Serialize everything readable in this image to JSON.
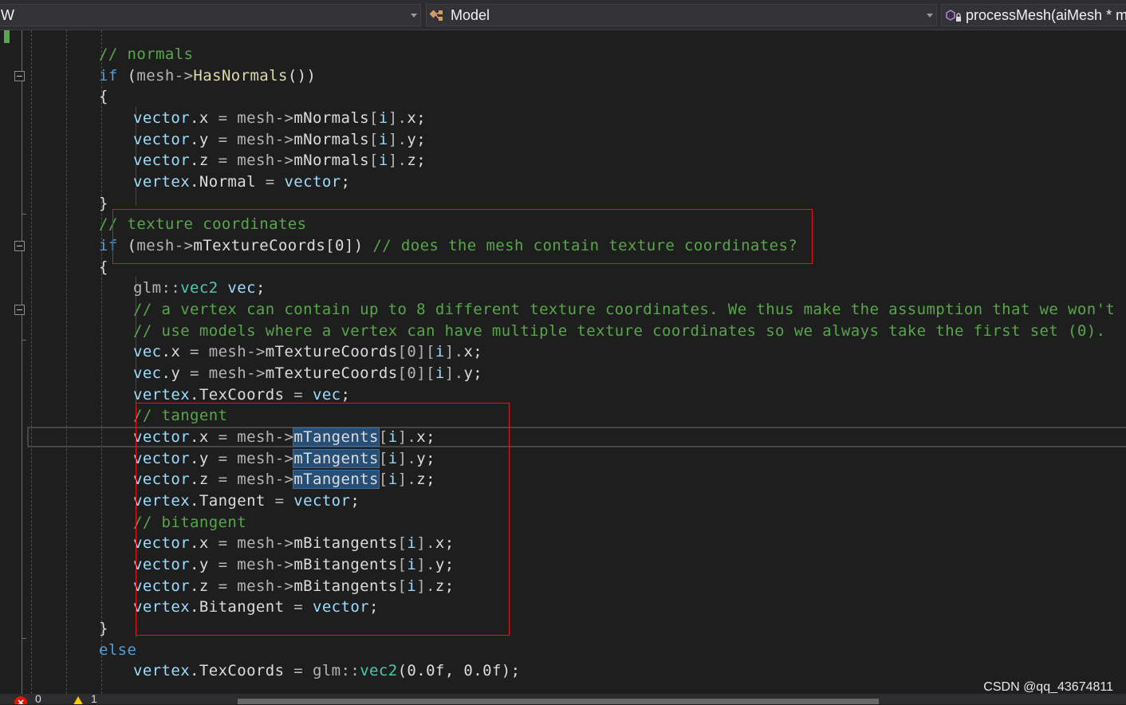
{
  "navbar": {
    "project_text": "W",
    "class_text": "Model",
    "member_text": "processMesh(aiMesh * m"
  },
  "icons": {
    "class": "class-icon",
    "member": "method-icon",
    "error": "error-icon",
    "warning": "warning-icon"
  },
  "status": {
    "errors": "0",
    "warnings": "1"
  },
  "watermark": "CSDN @qq_43674811",
  "colors": {
    "comment": "#57a64a",
    "keyword": "#569cd6",
    "identifier": "#9cdcfe",
    "function": "#dcdcaa",
    "type": "#4ec9b0",
    "highlight_box": "#e81123",
    "selection": "#264f78"
  },
  "code": {
    "lines": [
      {
        "indent": 2,
        "tokens": [
          {
            "t": "// normals",
            "c": "cm"
          }
        ]
      },
      {
        "indent": 2,
        "tokens": [
          {
            "t": "if",
            "c": "kw"
          },
          {
            "t": " ("
          },
          {
            "t": "mesh",
            "c": "op"
          },
          {
            "t": "->",
            "c": "op"
          },
          {
            "t": "HasNormals",
            "c": "fn"
          },
          {
            "t": "())"
          }
        ]
      },
      {
        "indent": 2,
        "tokens": [
          {
            "t": "{"
          }
        ]
      },
      {
        "indent": 3,
        "tokens": [
          {
            "t": "vector",
            "c": "id"
          },
          {
            "t": "."
          },
          {
            "t": "x"
          },
          {
            "t": " = ",
            "c": "op"
          },
          {
            "t": "mesh",
            "c": "op"
          },
          {
            "t": "->",
            "c": "op"
          },
          {
            "t": "mNormals"
          },
          {
            "t": "[",
            "c": "op"
          },
          {
            "t": "i",
            "c": "id"
          },
          {
            "t": "].",
            "c": "op"
          },
          {
            "t": "x"
          },
          {
            "t": ";"
          }
        ]
      },
      {
        "indent": 3,
        "tokens": [
          {
            "t": "vector",
            "c": "id"
          },
          {
            "t": "."
          },
          {
            "t": "y"
          },
          {
            "t": " = ",
            "c": "op"
          },
          {
            "t": "mesh",
            "c": "op"
          },
          {
            "t": "->",
            "c": "op"
          },
          {
            "t": "mNormals"
          },
          {
            "t": "[",
            "c": "op"
          },
          {
            "t": "i",
            "c": "id"
          },
          {
            "t": "].",
            "c": "op"
          },
          {
            "t": "y"
          },
          {
            "t": ";"
          }
        ]
      },
      {
        "indent": 3,
        "tokens": [
          {
            "t": "vector",
            "c": "id"
          },
          {
            "t": "."
          },
          {
            "t": "z"
          },
          {
            "t": " = ",
            "c": "op"
          },
          {
            "t": "mesh",
            "c": "op"
          },
          {
            "t": "->",
            "c": "op"
          },
          {
            "t": "mNormals"
          },
          {
            "t": "[",
            "c": "op"
          },
          {
            "t": "i",
            "c": "id"
          },
          {
            "t": "].",
            "c": "op"
          },
          {
            "t": "z"
          },
          {
            "t": ";"
          }
        ]
      },
      {
        "indent": 3,
        "tokens": [
          {
            "t": "vertex",
            "c": "id"
          },
          {
            "t": "."
          },
          {
            "t": "Normal"
          },
          {
            "t": " = ",
            "c": "op"
          },
          {
            "t": "vector",
            "c": "id"
          },
          {
            "t": ";"
          }
        ]
      },
      {
        "indent": 2,
        "tokens": [
          {
            "t": "}"
          }
        ]
      },
      {
        "indent": 2,
        "tokens": [
          {
            "t": "// texture coordinates",
            "c": "cm"
          }
        ]
      },
      {
        "indent": 2,
        "tokens": [
          {
            "t": "if",
            "c": "kw"
          },
          {
            "t": " ("
          },
          {
            "t": "mesh",
            "c": "op"
          },
          {
            "t": "->",
            "c": "op"
          },
          {
            "t": "mTextureCoords"
          },
          {
            "t": "[0])"
          },
          {
            "t": " // does the mesh contain texture coordinates?",
            "c": "cm"
          }
        ]
      },
      {
        "indent": 2,
        "tokens": [
          {
            "t": "{"
          }
        ]
      },
      {
        "indent": 3,
        "tokens": [
          {
            "t": "glm",
            "c": "op"
          },
          {
            "t": "::",
            "c": "op"
          },
          {
            "t": "vec2",
            "c": "ty"
          },
          {
            "t": " "
          },
          {
            "t": "vec",
            "c": "id"
          },
          {
            "t": ";"
          }
        ]
      },
      {
        "indent": 3,
        "tokens": [
          {
            "t": "// a vertex can contain up to 8 different texture coordinates. We thus make the assumption that we won't",
            "c": "cm"
          }
        ]
      },
      {
        "indent": 3,
        "tokens": [
          {
            "t": "// use models where a vertex can have multiple texture coordinates so we always take the first set (0).",
            "c": "cm"
          }
        ]
      },
      {
        "indent": 3,
        "tokens": [
          {
            "t": "vec",
            "c": "id"
          },
          {
            "t": "."
          },
          {
            "t": "x"
          },
          {
            "t": " = ",
            "c": "op"
          },
          {
            "t": "mesh",
            "c": "op"
          },
          {
            "t": "->",
            "c": "op"
          },
          {
            "t": "mTextureCoords"
          },
          {
            "t": "[0][",
            "c": "op"
          },
          {
            "t": "i",
            "c": "id"
          },
          {
            "t": "].",
            "c": "op"
          },
          {
            "t": "x"
          },
          {
            "t": ";"
          }
        ]
      },
      {
        "indent": 3,
        "tokens": [
          {
            "t": "vec",
            "c": "id"
          },
          {
            "t": "."
          },
          {
            "t": "y"
          },
          {
            "t": " = ",
            "c": "op"
          },
          {
            "t": "mesh",
            "c": "op"
          },
          {
            "t": "->",
            "c": "op"
          },
          {
            "t": "mTextureCoords"
          },
          {
            "t": "[0][",
            "c": "op"
          },
          {
            "t": "i",
            "c": "id"
          },
          {
            "t": "].",
            "c": "op"
          },
          {
            "t": "y"
          },
          {
            "t": ";"
          }
        ]
      },
      {
        "indent": 3,
        "tokens": [
          {
            "t": "vertex",
            "c": "id"
          },
          {
            "t": "."
          },
          {
            "t": "TexCoords"
          },
          {
            "t": " = ",
            "c": "op"
          },
          {
            "t": "vec",
            "c": "id"
          },
          {
            "t": ";"
          }
        ]
      },
      {
        "indent": 3,
        "tokens": [
          {
            "t": "// tangent",
            "c": "cm"
          }
        ]
      },
      {
        "indent": 3,
        "tokens": [
          {
            "t": "vector",
            "c": "id"
          },
          {
            "t": "."
          },
          {
            "t": "x"
          },
          {
            "t": " = ",
            "c": "op"
          },
          {
            "t": "mesh",
            "c": "op"
          },
          {
            "t": "->",
            "c": "op"
          },
          {
            "t": "mTangents",
            "c": "hl"
          },
          {
            "t": "[",
            "c": "op"
          },
          {
            "t": "i",
            "c": "id"
          },
          {
            "t": "].",
            "c": "op"
          },
          {
            "t": "x"
          },
          {
            "t": ";"
          }
        ]
      },
      {
        "indent": 3,
        "tokens": [
          {
            "t": "vector",
            "c": "id"
          },
          {
            "t": "."
          },
          {
            "t": "y"
          },
          {
            "t": " = ",
            "c": "op"
          },
          {
            "t": "mesh",
            "c": "op"
          },
          {
            "t": "->",
            "c": "op"
          },
          {
            "t": "mTangents",
            "c": "hl"
          },
          {
            "t": "[",
            "c": "op"
          },
          {
            "t": "i",
            "c": "id"
          },
          {
            "t": "].",
            "c": "op"
          },
          {
            "t": "y"
          },
          {
            "t": ";"
          }
        ]
      },
      {
        "indent": 3,
        "tokens": [
          {
            "t": "vector",
            "c": "id"
          },
          {
            "t": "."
          },
          {
            "t": "z"
          },
          {
            "t": " = ",
            "c": "op"
          },
          {
            "t": "mesh",
            "c": "op"
          },
          {
            "t": "->",
            "c": "op"
          },
          {
            "t": "mTangents",
            "c": "hl"
          },
          {
            "t": "[",
            "c": "op"
          },
          {
            "t": "i",
            "c": "id"
          },
          {
            "t": "].",
            "c": "op"
          },
          {
            "t": "z"
          },
          {
            "t": ";"
          }
        ]
      },
      {
        "indent": 3,
        "tokens": [
          {
            "t": "vertex",
            "c": "id"
          },
          {
            "t": "."
          },
          {
            "t": "Tangent"
          },
          {
            "t": " = ",
            "c": "op"
          },
          {
            "t": "vector",
            "c": "id"
          },
          {
            "t": ";"
          }
        ]
      },
      {
        "indent": 3,
        "tokens": [
          {
            "t": "// bitangent",
            "c": "cm"
          }
        ]
      },
      {
        "indent": 3,
        "tokens": [
          {
            "t": "vector",
            "c": "id"
          },
          {
            "t": "."
          },
          {
            "t": "x"
          },
          {
            "t": " = ",
            "c": "op"
          },
          {
            "t": "mesh",
            "c": "op"
          },
          {
            "t": "->",
            "c": "op"
          },
          {
            "t": "mBitangents"
          },
          {
            "t": "[",
            "c": "op"
          },
          {
            "t": "i",
            "c": "id"
          },
          {
            "t": "].",
            "c": "op"
          },
          {
            "t": "x"
          },
          {
            "t": ";"
          }
        ]
      },
      {
        "indent": 3,
        "tokens": [
          {
            "t": "vector",
            "c": "id"
          },
          {
            "t": "."
          },
          {
            "t": "y"
          },
          {
            "t": " = ",
            "c": "op"
          },
          {
            "t": "mesh",
            "c": "op"
          },
          {
            "t": "->",
            "c": "op"
          },
          {
            "t": "mBitangents"
          },
          {
            "t": "[",
            "c": "op"
          },
          {
            "t": "i",
            "c": "id"
          },
          {
            "t": "].",
            "c": "op"
          },
          {
            "t": "y"
          },
          {
            "t": ";"
          }
        ]
      },
      {
        "indent": 3,
        "tokens": [
          {
            "t": "vector",
            "c": "id"
          },
          {
            "t": "."
          },
          {
            "t": "z"
          },
          {
            "t": " = ",
            "c": "op"
          },
          {
            "t": "mesh",
            "c": "op"
          },
          {
            "t": "->",
            "c": "op"
          },
          {
            "t": "mBitangents"
          },
          {
            "t": "[",
            "c": "op"
          },
          {
            "t": "i",
            "c": "id"
          },
          {
            "t": "].",
            "c": "op"
          },
          {
            "t": "z"
          },
          {
            "t": ";"
          }
        ]
      },
      {
        "indent": 3,
        "tokens": [
          {
            "t": "vertex",
            "c": "id"
          },
          {
            "t": "."
          },
          {
            "t": "Bitangent"
          },
          {
            "t": " = ",
            "c": "op"
          },
          {
            "t": "vector",
            "c": "id"
          },
          {
            "t": ";"
          }
        ]
      },
      {
        "indent": 2,
        "tokens": [
          {
            "t": "}"
          }
        ]
      },
      {
        "indent": 2,
        "tokens": [
          {
            "t": "else",
            "c": "kw"
          }
        ]
      },
      {
        "indent": 3,
        "tokens": [
          {
            "t": "vertex",
            "c": "id"
          },
          {
            "t": "."
          },
          {
            "t": "TexCoords"
          },
          {
            "t": " = ",
            "c": "op"
          },
          {
            "t": "glm",
            "c": "op"
          },
          {
            "t": "::",
            "c": "op"
          },
          {
            "t": "vec2",
            "c": "ty"
          },
          {
            "t": "(0.0f, 0.0f);"
          }
        ]
      }
    ]
  }
}
